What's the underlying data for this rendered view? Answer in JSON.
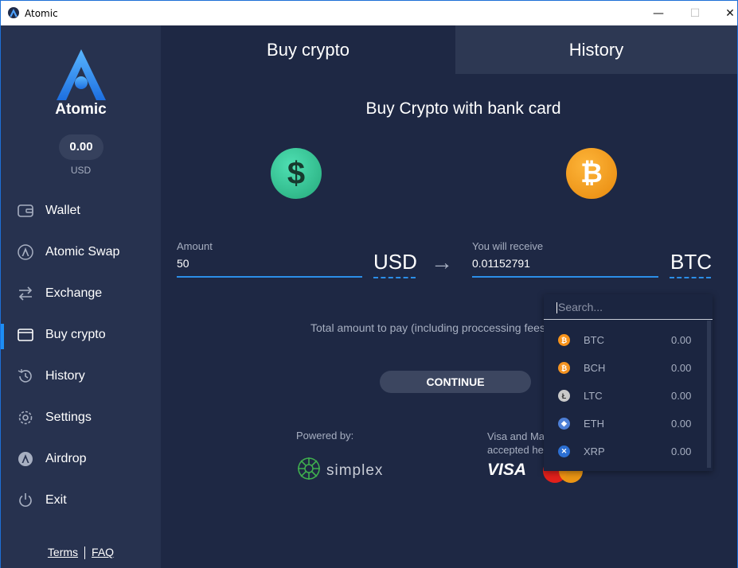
{
  "window": {
    "title": "Atomic",
    "controls": {
      "minimize": "—",
      "maximize": "☐",
      "close": "✕"
    }
  },
  "sidebar": {
    "brand": "Atomic",
    "balance": {
      "value": "0.00",
      "currency": "USD"
    },
    "items": [
      {
        "label": "Wallet",
        "icon": "wallet-icon"
      },
      {
        "label": "Atomic Swap",
        "icon": "atomic-swap-icon"
      },
      {
        "label": "Exchange",
        "icon": "exchange-icon"
      },
      {
        "label": "Buy crypto",
        "icon": "card-icon",
        "active": true
      },
      {
        "label": "History",
        "icon": "history-icon"
      },
      {
        "label": "Settings",
        "icon": "gear-icon"
      },
      {
        "label": "Airdrop",
        "icon": "airdrop-icon"
      },
      {
        "label": "Exit",
        "icon": "power-icon"
      }
    ],
    "footer": {
      "terms": "Terms",
      "faq": "FAQ"
    }
  },
  "tabs": {
    "buy": "Buy crypto",
    "history": "History"
  },
  "main": {
    "headline": "Buy Crypto with bank card",
    "usd_symbol": "$",
    "btc_symbol": "₿",
    "amount": {
      "label": "Amount",
      "value": "50",
      "currency": "USD"
    },
    "receive": {
      "label": "You will receive",
      "value": "0.01152791",
      "currency": "BTC"
    },
    "arrow": "→",
    "total_text": "Total amount to pay (including proccessing fees",
    "continue_label": "CONTINUE",
    "powered_by": "Powered by:",
    "simplex": "simplex",
    "visa_note_line1": "Visa and Ma",
    "visa_note_line2": "accepted he",
    "visa": "VISA"
  },
  "dropdown": {
    "search_placeholder": "Search...",
    "items": [
      {
        "symbol": "BTC",
        "balance": "0.00",
        "color": "#f7931a",
        "glyph": "₿"
      },
      {
        "symbol": "BCH",
        "balance": "0.00",
        "color": "#f39321",
        "glyph": "₿"
      },
      {
        "symbol": "LTC",
        "balance": "0.00",
        "color": "#c9c9c9",
        "glyph": "Ł"
      },
      {
        "symbol": "ETH",
        "balance": "0.00",
        "color": "#4d7fd6",
        "glyph": "◆"
      },
      {
        "symbol": "XRP",
        "balance": "0.00",
        "color": "#2c6fd2",
        "glyph": "✕"
      }
    ]
  }
}
